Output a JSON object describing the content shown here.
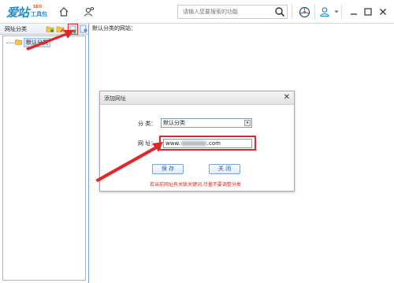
{
  "app": {
    "logo_main": "爱站",
    "logo_seo": "SEO",
    "logo_sub": "工具包"
  },
  "toolbar": {
    "search_placeholder": "请输入您要搜索的功能",
    "icons": [
      "home-icon",
      "user-settings-icon",
      "search-icon",
      "steering-wheel-icon",
      "user-icon",
      "dropdown-icon",
      "minimize-icon",
      "restore-icon",
      "close-icon"
    ]
  },
  "left_panel": {
    "header": "网址分类",
    "tools": [
      "add-folder-icon",
      "edit-folder-icon",
      "add-url-icon",
      "delete-icon"
    ],
    "tree": [
      {
        "label": "默认分类"
      }
    ]
  },
  "main": {
    "title": "默认分类的网站："
  },
  "dialog": {
    "title": "添加网址",
    "category_label": "分 类：",
    "category_value": "默认分类",
    "url_label": "网   址：",
    "url_prefix": "www.",
    "url_suffix": ".com",
    "save_label": "保 存",
    "close_label": "关 闭",
    "notice": "若当前网址有关联关键词,尽量不要调整分类"
  },
  "colors": {
    "accent": "#1e8fd6",
    "highlight": "#e02828",
    "border": "#7da2ce"
  }
}
